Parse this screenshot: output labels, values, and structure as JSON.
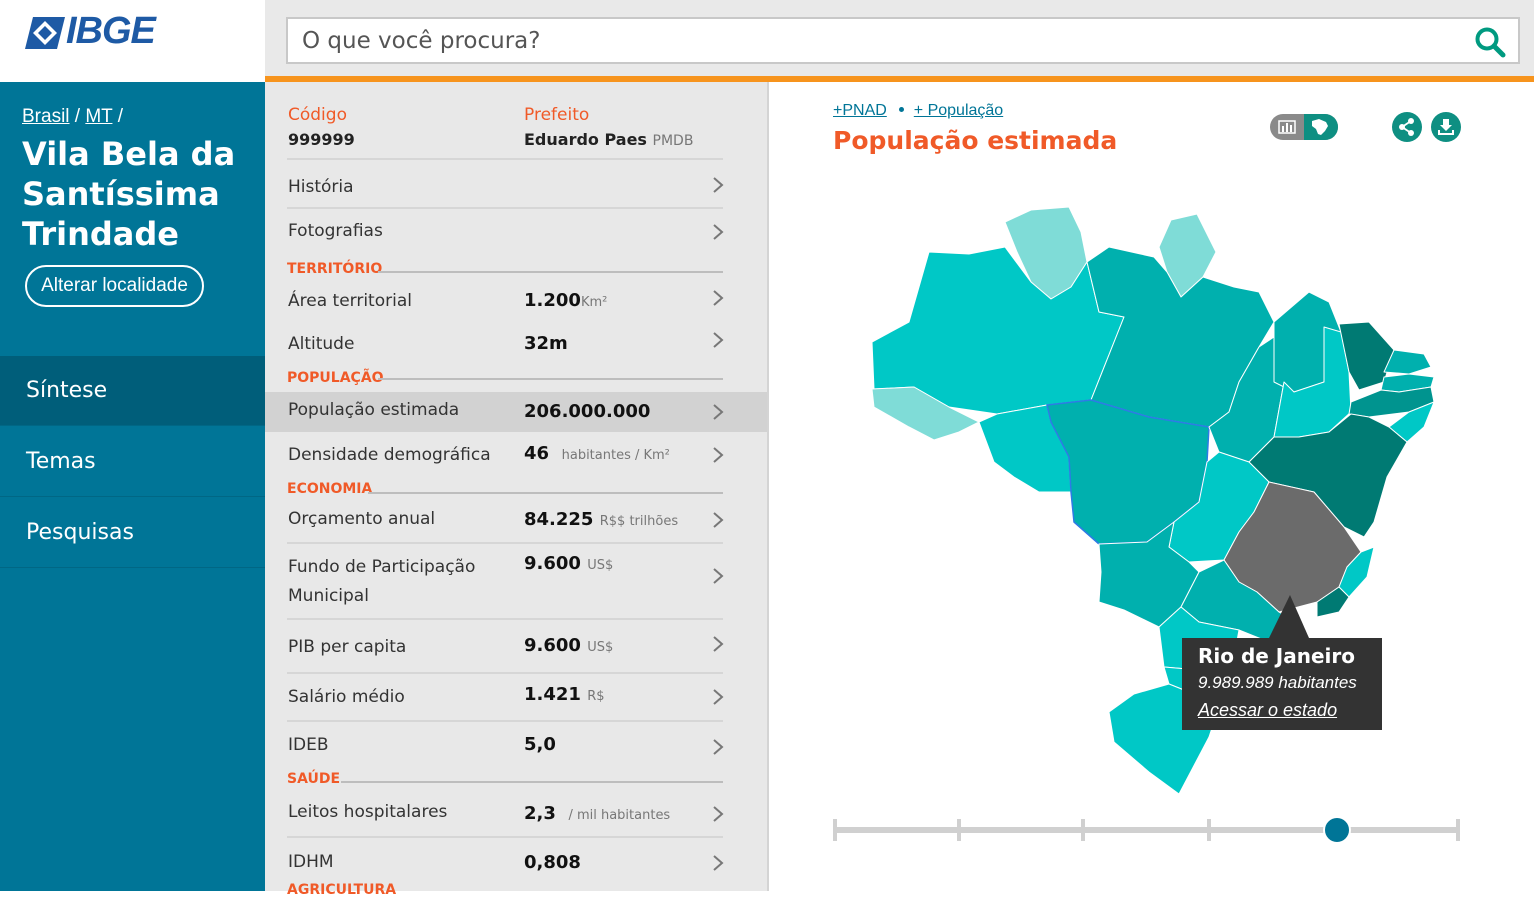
{
  "header": {
    "logo_text": "IBGE",
    "search_placeholder": "O que você procura?",
    "search_icon": "search-icon"
  },
  "sidebar": {
    "breadcrumb": [
      "Brasil",
      "MT"
    ],
    "breadcrumb_sep": "/",
    "city_lines": [
      "Vila Bela da",
      "Santíssima",
      "Trindade"
    ],
    "alter_button": "Alterar localidade",
    "nav": [
      {
        "label": "Síntese",
        "active": true
      },
      {
        "label": "Temas",
        "active": false
      },
      {
        "label": "Pesquisas",
        "active": false
      }
    ]
  },
  "summary": {
    "codigo_label": "Código",
    "codigo_value": "999999",
    "prefeito_label": "Prefeito",
    "prefeito_name": "Eduardo Paes",
    "prefeito_party": "PMDB",
    "rows": {
      "historia": "História",
      "fotografias": "Fotografias",
      "area_name": "Área territorial",
      "area_value": "1.200",
      "area_unit": "Km²",
      "altitude_name": "Altitude",
      "altitude_value": "32m",
      "pop_name": "População estimada",
      "pop_value": "206.000.000",
      "dens_name": "Densidade demográfica",
      "dens_value": "46",
      "dens_unit": "habitantes / Km²",
      "orc_name": "Orçamento anual",
      "orc_value": "84.225",
      "orc_unit": "R$$ trilhões",
      "fpm_name_1": "Fundo de Participação",
      "fpm_name_2": "Municipal",
      "fpm_value": "9.600",
      "fpm_unit": "US$",
      "pib_name": "PIB per capita",
      "pib_value": "9.600",
      "pib_unit": "US$",
      "sal_name": "Salário médio",
      "sal_value": "1.421",
      "sal_unit": "R$",
      "ideb_name": "IDEB",
      "ideb_value": "5,0",
      "leitos_name": "Leitos hospitalares",
      "leitos_value": "2,3",
      "leitos_unit": "/ mil habitantes",
      "idhm_name": "IDHM",
      "idhm_value": "0,808"
    },
    "sections": {
      "territorio": "TERRITÓRIO",
      "populacao": "POPULAÇÃO",
      "economia": "ECONOMIA",
      "saude": "SAÚDE",
      "agricultura": "AGRICULTURA"
    }
  },
  "map_panel": {
    "link_pnad": "+PNAD",
    "link_populacao": "+ População",
    "title": "População estimada",
    "icons": [
      "bar-chart-icon",
      "brazil-map-icon",
      "share-icon",
      "download-icon"
    ],
    "colors": {
      "lightest": "#7fdcd7",
      "light": "#00c8c6",
      "mid": "#00b0ae",
      "dark": "#00948f",
      "darkest": "#007a73",
      "selected": "#6b6b6b"
    },
    "tooltip": {
      "state": "Rio de Janeiro",
      "value": "9.989.989 habitantes",
      "link": "Acessar o estado"
    },
    "timeline": {
      "stops": 6,
      "selected_index": 4
    }
  }
}
